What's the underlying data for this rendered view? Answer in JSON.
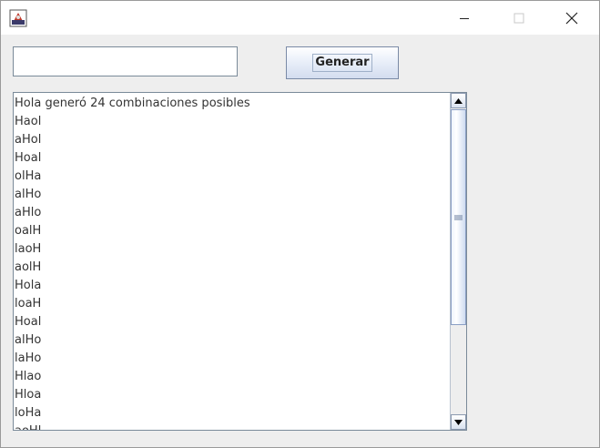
{
  "window": {
    "icon": "java-app-icon",
    "controls": {
      "minimize_icon": "minimize-icon",
      "maximize_icon": "maximize-icon",
      "close_icon": "close-icon"
    }
  },
  "form": {
    "input_value": "",
    "generate_label": "Generar"
  },
  "output": {
    "lines": [
      "Hola generó 24 combinaciones posibles",
      "Haol",
      "aHol",
      "Hoal",
      "olHa",
      "alHo",
      "aHlo",
      "oalH",
      "laoH",
      "aolH",
      "Hola",
      "loaH",
      "Hoal",
      "alHo",
      "laHo",
      "Hlao",
      "Hloa",
      "loHa",
      "aoHl"
    ]
  },
  "colors": {
    "window_bg": "#eeeeee",
    "titlebar_bg": "#ffffff",
    "list_text": "#333333",
    "button_border": "#7a8aa6"
  }
}
